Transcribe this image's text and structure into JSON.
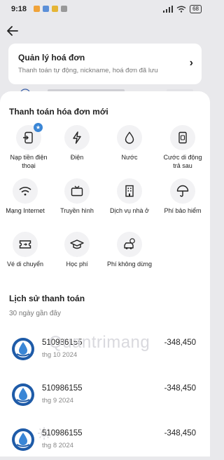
{
  "status_bar": {
    "time": "9:18",
    "battery": "68"
  },
  "bill_card": {
    "title": "Quản lý hoá đơn",
    "subtitle": "Thanh toán tự động, nickname, hoá đơn đã lưu"
  },
  "new_payment": {
    "title": "Thanh toán hóa đơn mới",
    "services": [
      {
        "label": "Nạp tiền điện thoại",
        "icon": "phone-topup-icon"
      },
      {
        "label": "Điện",
        "icon": "lightning-icon"
      },
      {
        "label": "Nước",
        "icon": "water-drop-icon"
      },
      {
        "label": "Cước di động trả sau",
        "icon": "sim-card-icon"
      },
      {
        "label": "Mạng Internet",
        "icon": "wifi-icon"
      },
      {
        "label": "Truyền hình",
        "icon": "tv-icon"
      },
      {
        "label": "Dịch vụ nhà ở",
        "icon": "building-icon"
      },
      {
        "label": "Phí bảo hiểm",
        "icon": "umbrella-icon"
      },
      {
        "label": "Vé di chuyển",
        "icon": "ticket-icon"
      },
      {
        "label": "Học phí",
        "icon": "graduation-cap-icon"
      },
      {
        "label": "Phí không dừng",
        "icon": "car-toll-icon"
      }
    ]
  },
  "history": {
    "title": "Lịch sử thanh toán",
    "subtitle": "30 ngày gần đây",
    "transactions": [
      {
        "id": "510986155",
        "date": "thg 10 2024",
        "amount": "-348,450"
      },
      {
        "id": "510986155",
        "date": "thg 9 2024",
        "amount": "-348,450"
      },
      {
        "id": "510986155",
        "date": "thg 8 2024",
        "amount": "-348,450"
      }
    ]
  },
  "watermark": "Quantrimang",
  "colors": {
    "accent": "#3a86d6",
    "logo_blue": "#1e5ba8",
    "sheet": "#ffffff",
    "backdrop": "#e9e9ec"
  }
}
